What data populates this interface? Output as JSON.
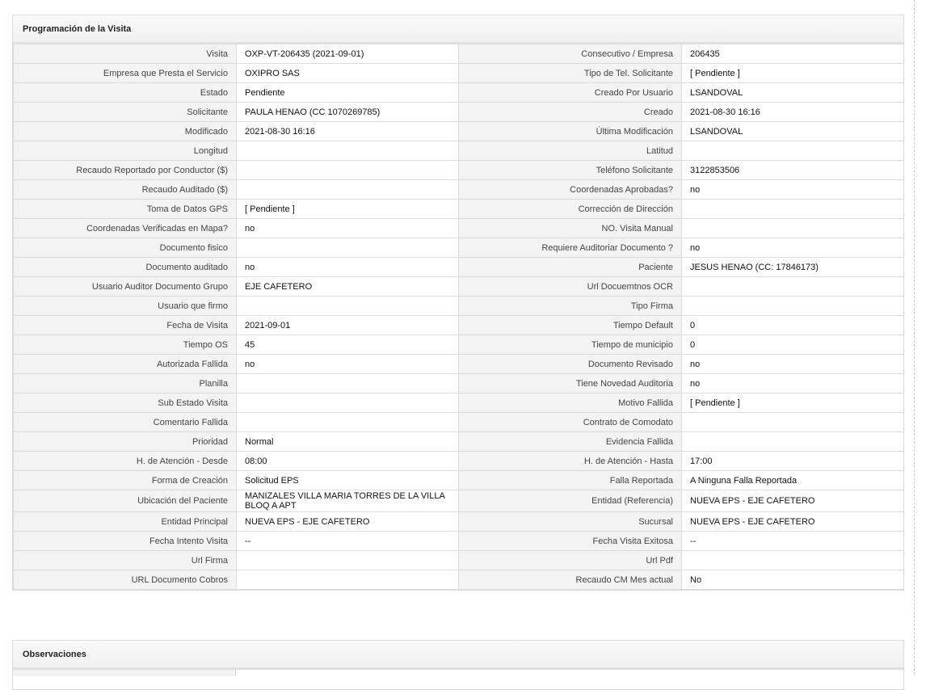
{
  "visit_section": {
    "title": "Programación de la Visita",
    "rows": [
      {
        "l1": "Visita",
        "v1": "OXP-VT-206435 (2021-09-01)",
        "l2": "Consecutivo / Empresa",
        "v2": "206435"
      },
      {
        "l1": "Empresa que Presta el Servicio",
        "v1": "OXIPRO SAS",
        "l2": "Tipo de Tel. Solicitante",
        "v2": "[ Pendiente ]"
      },
      {
        "l1": "Estado",
        "v1": "Pendiente",
        "l2": "Creado Por Usuario",
        "v2": "LSANDOVAL"
      },
      {
        "l1": "Solicitante",
        "v1": "PAULA HENAO (CC 1070269785)",
        "l2": "Creado",
        "v2": "2021-08-30 16:16"
      },
      {
        "l1": "Modificado",
        "v1": "2021-08-30 16:16",
        "l2": "Última Modificación",
        "v2": " LSANDOVAL"
      },
      {
        "l1": "Longitud",
        "v1": "",
        "l2": "Latitud",
        "v2": ""
      },
      {
        "l1": "Recaudo Reportado por Conductor ($)",
        "v1": "",
        "l2": "Teléfono Solicitante",
        "v2": "3122853506"
      },
      {
        "l1": "Recaudo Auditado ($)",
        "v1": "",
        "l2": "Coordenadas Aprobadas?",
        "v2": " no"
      },
      {
        "l1": "Toma de Datos GPS",
        "v1": "[ Pendiente ]",
        "l2": "Corrección de Dirección",
        "v2": ""
      },
      {
        "l1": "Coordenadas Verificadas en Mapa?",
        "v1": " no",
        "l2": "NO. Visita Manual",
        "v2": ""
      },
      {
        "l1": "Documento fisico",
        "v1": "",
        "l2": "Requiere Auditoriar Documento ?",
        "v2": " no"
      },
      {
        "l1": "Documento auditado",
        "v1": " no",
        "l2": "Paciente",
        "v2": "JESUS HENAO (CC: 17846173)"
      },
      {
        "l1": "Usuario Auditor Documento Grupo",
        "v1": "EJE CAFETERO",
        "l2": "Url Docuemtnos OCR",
        "v2": ""
      },
      {
        "l1": "Usuario que firmo",
        "v1": "",
        "l2": "Tipo Firma",
        "v2": ""
      },
      {
        "l1": "Fecha de Visita",
        "v1": " 2021-09-01",
        "l2": "Tiempo Default",
        "v2": "0"
      },
      {
        "l1": "Tiempo OS",
        "v1": "45",
        "l2": "Tiempo de municipio",
        "v2": "0"
      },
      {
        "l1": "Autorizada Fallida",
        "v1": " no",
        "l2": "Documento Revisado",
        "v2": " no"
      },
      {
        "l1": "Planilla",
        "v1": "",
        "l2": "Tiene Novedad Auditoria",
        "v2": " no"
      },
      {
        "l1": "Sub Estado Visita",
        "v1": "",
        "l2": "Motivo Fallida",
        "v2": "[ Pendiente ]"
      },
      {
        "l1": "Comentario Fallida",
        "v1": "",
        "l2": "Contrato de Comodato",
        "v2": ""
      },
      {
        "l1": "Prioridad",
        "v1": "Normal",
        "l2": "Evidencia Fallida",
        "v2": ""
      },
      {
        "l1": "H. de Atención - Desde",
        "v1": "08:00",
        "l2": "H. de Atención - Hasta",
        "v2": "17:00"
      },
      {
        "l1": "Forma de Creación",
        "v1": "Solicitud EPS",
        "l2": "Falla Reportada",
        "v2": "A Ninguna Falla Reportada"
      },
      {
        "l1": "Ubicación del Paciente",
        "v1": "MANIZALES VILLA MARIA TORRES DE LA VILLA BLOQ A APT",
        "l2": "Entidad (Referencia)",
        "v2": "NUEVA EPS - EJE CAFETERO"
      },
      {
        "l1": "Entidad Principal",
        "v1": "NUEVA EPS - EJE CAFETERO",
        "l2": "Sucursal",
        "v2": "NUEVA EPS - EJE CAFETERO"
      },
      {
        "l1": "Fecha Intento Visita",
        "v1": " --",
        "l2": "Fecha Visita Exitosa",
        "v2": " --"
      },
      {
        "l1": "Url Firma",
        "v1": "",
        "l2": "Url Pdf",
        "v2": ""
      },
      {
        "l1": "URL Documento Cobros",
        "v1": "",
        "l2": "Recaudo CM Mes actual",
        "v2": "No"
      }
    ]
  },
  "observations_section": {
    "title": "Observaciones"
  }
}
